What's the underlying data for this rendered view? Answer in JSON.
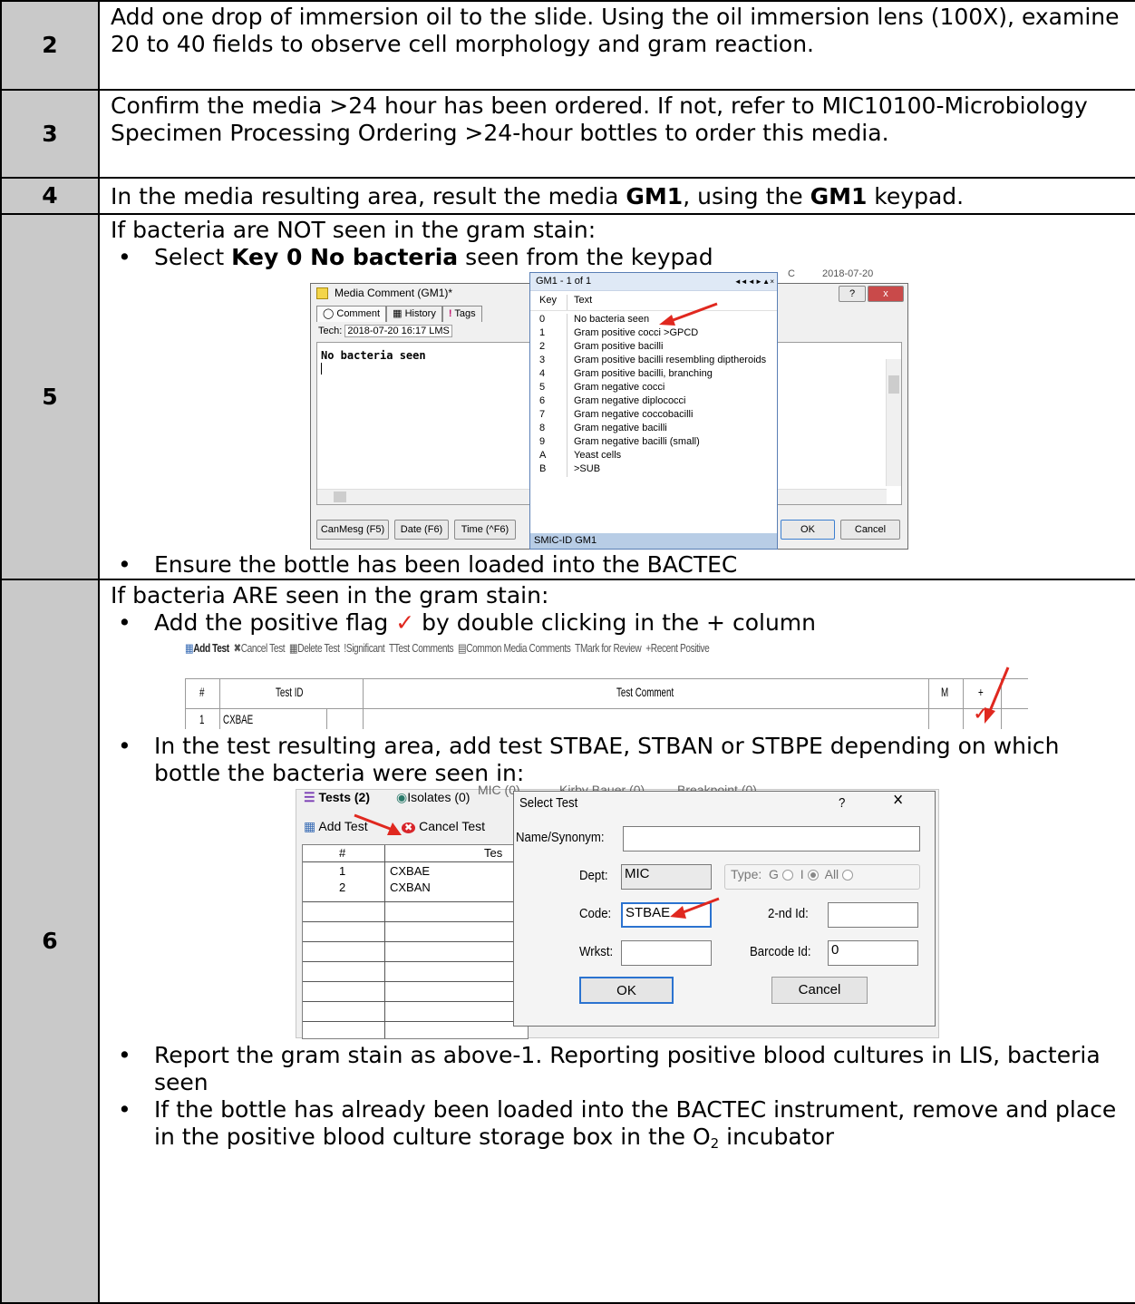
{
  "colors": {
    "step_bg": "#c9c9c9",
    "accent_red": "#e0281f"
  },
  "rows": {
    "r2": {
      "step": "2",
      "text": "Add one drop of immersion oil to the slide. Using the oil immersion lens (100X), examine 20 to 40 fields to observe cell morphology and gram reaction."
    },
    "r3": {
      "step": "3",
      "text": "Confirm the media >24 hour has been ordered. If not, refer to MIC10100-Microbiology Specimen Processing Ordering >24-hour bottles to order this media."
    },
    "r4": {
      "step": "4",
      "t1": "In the media resulting area, result the media ",
      "b1": "GM1",
      "t2": ", using the ",
      "b2": "GM1",
      "t3": " keypad."
    },
    "r5": {
      "step": "5",
      "intro": "If bacteria are NOT seen in the gram stain:",
      "b1_t1": "Select ",
      "b1_bold": "Key 0 No bacteria",
      "b1_t2": " seen from the keypad",
      "b2": "Ensure the bottle has been loaded into the BACTEC"
    },
    "r6": {
      "step": "6",
      "intro": "If bacteria ARE seen in the gram stain:",
      "b1_t1": "Add the positive flag ",
      "b1_check": "✓",
      "b1_t2": " by double clicking in the + column",
      "b2": "In the test resulting area, add test STBAE, STBAN or STBPE depending on which bottle the bacteria were seen in:",
      "b3": "Report the gram stain as above-1. Reporting positive blood cultures in LIS, bacteria seen",
      "b4_t1": "If the bottle has already been loaded into the BACTEC instrument, remove and place in the positive blood culture storage box in the O",
      "b4_sub": "2",
      "b4_t2": " incubator"
    }
  },
  "media_comment": {
    "title": "Media Comment (GM1)*",
    "tabs": [
      "Comment",
      "History",
      "Tags"
    ],
    "tech_label": "Tech:",
    "tech_value": "2018-07-20  16:17  LMS",
    "comment_text": "No bacteria seen",
    "buttons": [
      "CanMesg (F5)",
      "Date (F6)",
      "Time (^F6)"
    ],
    "ok": "OK",
    "cancel": "Cancel",
    "bg_col_c": "C",
    "bg_date": "2018-07-20",
    "help": "?",
    "close": "x"
  },
  "keypad": {
    "title": "GM1  - 1 of 1",
    "nav": "◄◄ ◄ ► ▲ ×",
    "col_key": "Key",
    "col_text": "Text",
    "rows": [
      {
        "key": "0",
        "text": "No bacteria seen"
      },
      {
        "key": "1",
        "text": "Gram positive cocci  >GPCD"
      },
      {
        "key": "2",
        "text": "Gram positive bacilli"
      },
      {
        "key": "3",
        "text": "Gram positive bacilli resembling diptheroids"
      },
      {
        "key": "4",
        "text": "Gram positive bacilli, branching"
      },
      {
        "key": "5",
        "text": "Gram negative cocci"
      },
      {
        "key": "6",
        "text": "Gram negative diplococci"
      },
      {
        "key": "7",
        "text": "Gram negative coccobacilli"
      },
      {
        "key": "8",
        "text": "Gram negative bacilli"
      },
      {
        "key": "9",
        "text": "Gram negative bacilli (small)"
      },
      {
        "key": "A",
        "text": "Yeast cells"
      },
      {
        "key": "B",
        "text": ">SUB"
      }
    ],
    "footer": "SMIC-ID GM1"
  },
  "test_grid": {
    "toolbar": [
      "Add Test",
      "Cancel Test",
      "Delete Test",
      "Significant",
      "Test Comments",
      "Common Media Comments",
      "Mark for Review",
      "Recent Positive"
    ],
    "headers": [
      "#",
      "Test ID",
      "Test Comment",
      "M",
      "+"
    ],
    "row_num": "1",
    "row_test": "CXBAE",
    "row_flag": "✓"
  },
  "tests_panel": {
    "tabs": [
      "Tests (2)",
      "Isolates (0)",
      "MIC (0)",
      "Kirby Bauer (0)",
      "Breakpoint (0)"
    ],
    "add_test": "Add Test",
    "cancel_test": "Cancel Test",
    "col_num": "#",
    "col_test": "Tes",
    "rows": [
      {
        "num": "1",
        "id": "CXBAE"
      },
      {
        "num": "2",
        "id": "CXBAN"
      }
    ]
  },
  "select_test": {
    "title": "Select Test",
    "help": "?",
    "close": "×",
    "name_label": "Name/Synonym:",
    "dept_label": "Dept:",
    "dept_value": "MIC",
    "type_label": "Type:",
    "type_g": "G",
    "type_i": "I",
    "type_all": "All",
    "code_label": "Code:",
    "code_value": "STBAE",
    "second_id_label": "2-nd Id:",
    "wrkst_label": "Wrkst:",
    "barcode_label": "Barcode Id:",
    "barcode_value": "0",
    "ok": "OK",
    "cancel": "Cancel"
  }
}
